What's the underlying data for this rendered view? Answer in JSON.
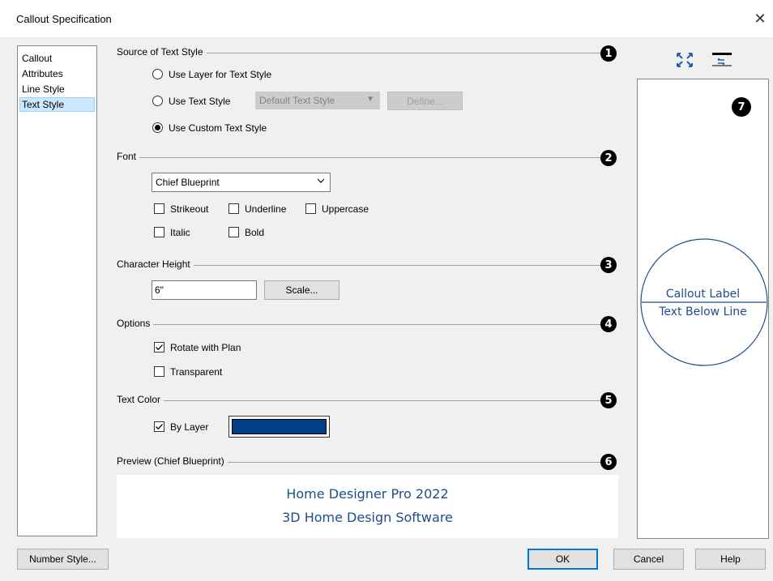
{
  "window": {
    "title": "Callout Specification",
    "close_glyph": "✕"
  },
  "nav": {
    "items": [
      "Callout",
      "Attributes",
      "Line Style",
      "Text Style"
    ],
    "selected": "Text Style"
  },
  "source": {
    "header": "Source of Text Style",
    "badge": "1",
    "use_layer": "Use Layer for Text Style",
    "use_text_style": "Use Text Style",
    "text_style_value": "Default Text Style",
    "define": "Define...",
    "use_custom": "Use Custom Text Style"
  },
  "font": {
    "header": "Font",
    "badge": "2",
    "value": "Chief Blueprint",
    "strikeout": "Strikeout",
    "underline": "Underline",
    "uppercase": "Uppercase",
    "italic": "Italic",
    "bold": "Bold"
  },
  "char_height": {
    "header": "Character Height",
    "badge": "3",
    "value": "6\"",
    "scale": "Scale..."
  },
  "options": {
    "header": "Options",
    "badge": "4",
    "rotate": "Rotate with Plan",
    "rotate_checked": true,
    "transparent": "Transparent",
    "transparent_checked": false
  },
  "text_color": {
    "header": "Text Color",
    "badge": "5",
    "by_layer": "By Layer",
    "by_layer_checked": true,
    "swatch_color": "#003f86"
  },
  "preview": {
    "header": "Preview (Chief Blueprint)",
    "badge": "6",
    "line1": "Home Designer Pro 2022",
    "line2": "3D Home Design Software",
    "text_color": "#1f4e8c"
  },
  "right": {
    "badge": "7",
    "callout_label": "Callout Label",
    "text_below": "Text Below Line",
    "fit_icon": "fit-window-icon",
    "swap_icon": "swap-icon"
  },
  "footer": {
    "number_style": "Number Style...",
    "ok": "OK",
    "cancel": "Cancel",
    "help": "Help"
  }
}
